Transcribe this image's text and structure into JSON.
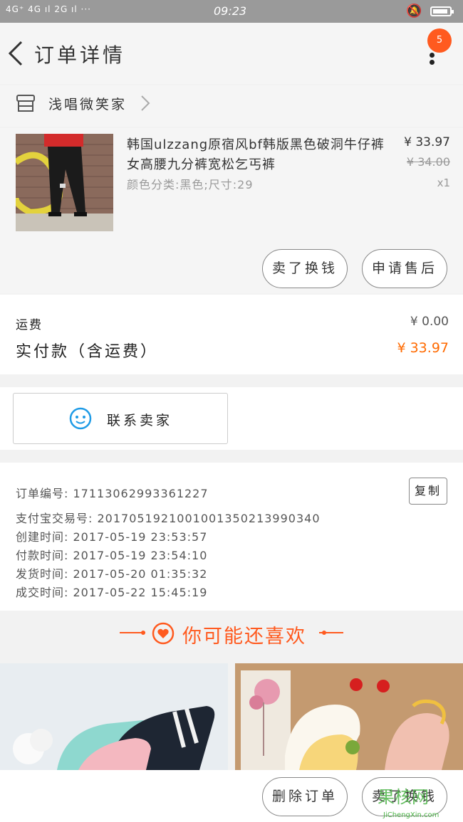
{
  "status_bar": {
    "network": "4G⁺ 4G ıl 2G ıl ···",
    "time": "09:23",
    "battery_level": 0.9
  },
  "header": {
    "title": "订单详情",
    "badge_count": "5",
    "back_icon": "chevron-left-icon",
    "more_icon": "more-vertical-icon"
  },
  "shop": {
    "name": "浅唱微笑家",
    "icon": "store-icon"
  },
  "product": {
    "title": "韩国ulzzang原宿风bf韩版黑色破洞牛仔裤女高腰九分裤宽松乞丐裤",
    "sku": "颜色分类:黑色;尺寸:29",
    "price": "¥ 33.97",
    "original_price": "¥ 34.00",
    "quantity": "x1",
    "buttons": [
      "卖了换钱",
      "申请售后"
    ]
  },
  "cost": {
    "shipping_label": "运费",
    "shipping_value": "¥ 0.00",
    "paid_label": "实付款（含运费）",
    "paid_value": "¥ 33.97"
  },
  "contact": {
    "label": "联系卖家"
  },
  "order_info": {
    "lines": [
      "订单编号: 17113062993361227",
      "支付宝交易号: 2017051921001001350213990340",
      "创建时间: 2017-05-19 23:53:57",
      "付款时间: 2017-05-19 23:54:10",
      "发货时间: 2017-05-20 01:35:32",
      "成交时间: 2017-05-22 15:45:19"
    ],
    "copy_label": "复制"
  },
  "recommend": {
    "title": "你可能还喜欢"
  },
  "bottom_bar": {
    "buttons": [
      "删除订单",
      "卖了换钱"
    ]
  },
  "watermark": {
    "text": "果核网",
    "sub": "JiChengXin.com"
  },
  "colors": {
    "accent": "#ff5a1f",
    "price_paid": "#ff6a00",
    "chat_icon": "#1e9be6"
  }
}
